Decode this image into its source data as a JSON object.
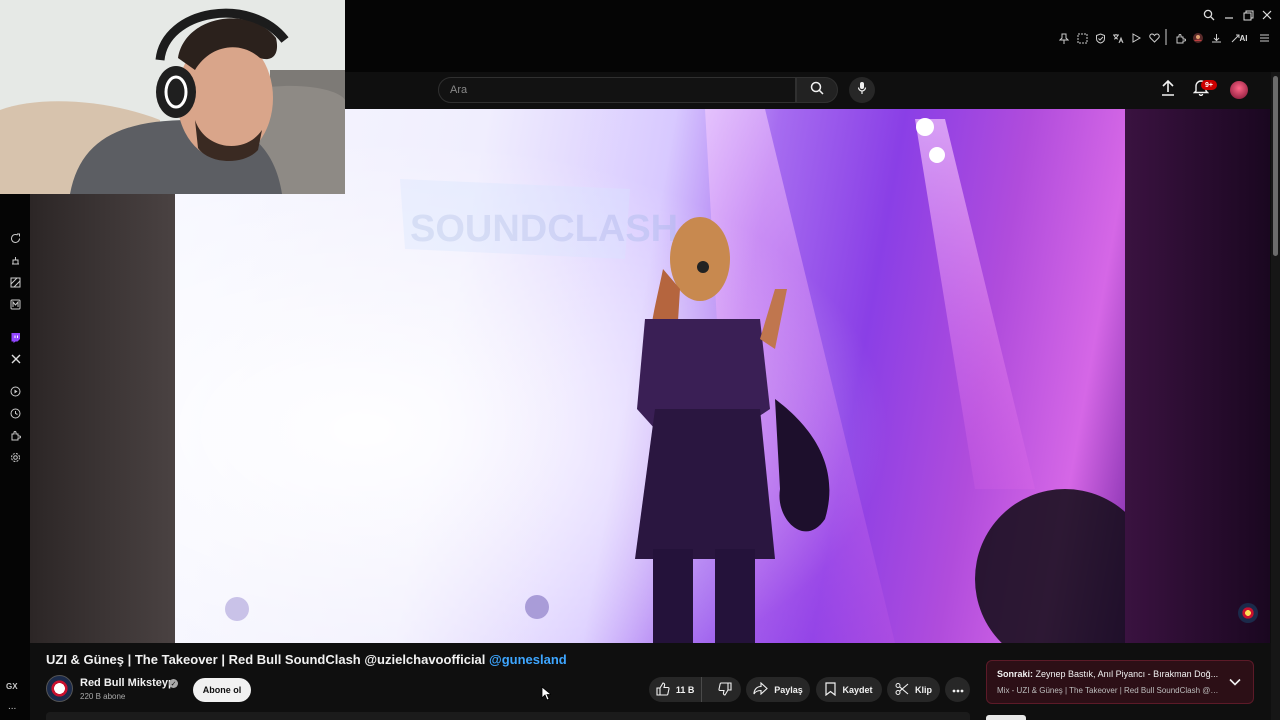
{
  "search": {
    "placeholder": "Ara"
  },
  "notifications": {
    "badge": "9+"
  },
  "extensions": {
    "ai_label": "AI"
  },
  "video": {
    "title": "UZI & Güneş | The Takeover | Red Bull SoundClash @uzielchavoofficial",
    "title_mention": "@gunesland",
    "stage_banner_text": "SOUNDCLASH"
  },
  "channel": {
    "name": "Red Bull Miksteyp",
    "subscribers": "220 B abone",
    "subscribe_label": "Abone ol"
  },
  "actions": {
    "like_count": "11 B",
    "share_label": "Paylaş",
    "save_label": "Kaydet",
    "clip_label": "Klip"
  },
  "up_next": {
    "prefix": "Sonraki:",
    "title": "Zeynep Bastık, Anıl Piyancı - Bırakman Doğ...",
    "subtitle": "Mix - UZI & Güneş | The Takeover | Red Bull SoundClash @uz..."
  },
  "opera_sidebar": {
    "gx_label": "GX",
    "more_label": "..."
  },
  "colors": {
    "accent_red": "#cc0000",
    "mention_blue": "#3ea6ff",
    "up_next_bg": "#2c0f16"
  }
}
